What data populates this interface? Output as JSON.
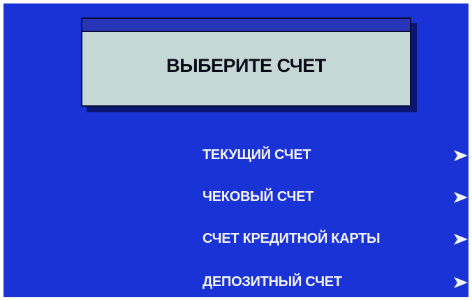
{
  "title": "ВЫБЕРИТЕ СЧЕТ",
  "menu": {
    "items": [
      {
        "label": "ТЕКУЩИЙ СЧЕТ",
        "icon": "arrow-right-icon"
      },
      {
        "label": "ЧЕКОВЫЙ СЧЕТ",
        "icon": "arrow-right-icon"
      },
      {
        "label": "СЧЕТ КРЕДИТНОЙ КАРТЫ",
        "icon": "arrow-right-icon"
      },
      {
        "label": "ДЕПОЗИТНЫЙ СЧЕТ",
        "icon": "arrow-right-icon"
      }
    ]
  },
  "colors": {
    "screen_background": "#1a33d6",
    "panel_background": "#c6d8d6",
    "panel_header": "#2a36b8",
    "text_light": "#f4f4f8",
    "text_dark": "#0b0b18"
  }
}
